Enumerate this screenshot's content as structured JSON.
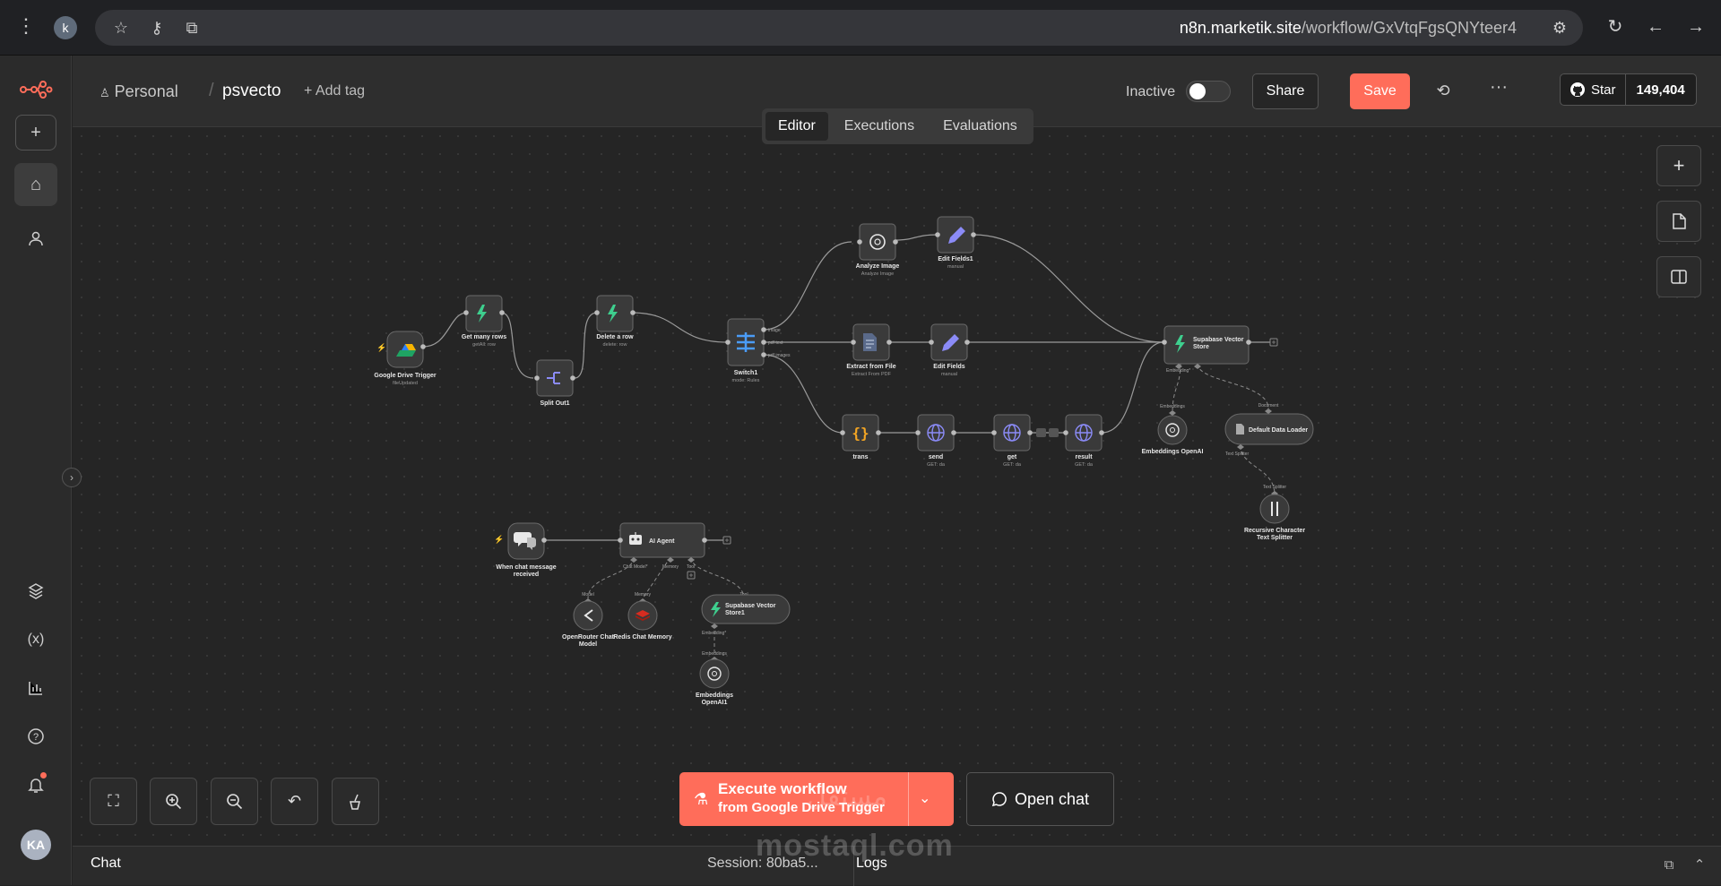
{
  "browser": {
    "avatar_letter": "k",
    "url_host": "n8n.marketik.site",
    "url_path": "/workflow/GxVtqFgsQNYteer4"
  },
  "header": {
    "breadcrumb_personal": "Personal",
    "project_name": "psvecto",
    "add_tag": "+ Add tag",
    "status_label": "Inactive",
    "share_label": "Share",
    "save_label": "Save",
    "github_star_label": "Star",
    "github_star_count": "149,404"
  },
  "tabs": [
    {
      "label": "Editor",
      "active": true
    },
    {
      "label": "Executions",
      "active": false
    },
    {
      "label": "Evaluations",
      "active": false
    }
  ],
  "sidebar": {
    "avatar_initials": "KA"
  },
  "workflow": {
    "nodes": [
      {
        "id": "gdrive",
        "label": "Google Drive Trigger",
        "sub": "fileUpdated"
      },
      {
        "id": "getrows",
        "label": "Get many rows",
        "sub": "getAll: row"
      },
      {
        "id": "split",
        "label": "Split Out1",
        "sub": ""
      },
      {
        "id": "delete",
        "label": "Delete a row",
        "sub": "delete: row"
      },
      {
        "id": "switch",
        "label": "Switch1",
        "sub": "mode: Rules"
      },
      {
        "id": "analyze",
        "label": "Analyze Image",
        "sub": "Analyze Image"
      },
      {
        "id": "edit1",
        "label": "Edit Fields1",
        "sub": "manual"
      },
      {
        "id": "extract",
        "label": "Extract from File",
        "sub": "Extract From PDF"
      },
      {
        "id": "edit",
        "label": "Edit Fields",
        "sub": "manual"
      },
      {
        "id": "trans",
        "label": "trans",
        "sub": ""
      },
      {
        "id": "send",
        "label": "send",
        "sub": "GET: da"
      },
      {
        "id": "get",
        "label": "get",
        "sub": "GET: da"
      },
      {
        "id": "result",
        "label": "result",
        "sub": "GET: da"
      },
      {
        "id": "supabase",
        "label": "Supabase Vector Store",
        "sub": ""
      },
      {
        "id": "emb1",
        "label": "Embeddings OpenAI",
        "sub": ""
      },
      {
        "id": "loader",
        "label": "Default Data Loader",
        "sub": ""
      },
      {
        "id": "splitter",
        "label": "Recursive Character Text Splitter",
        "sub": ""
      },
      {
        "id": "chat",
        "label": "When chat message received",
        "sub": ""
      },
      {
        "id": "agent",
        "label": "AI Agent",
        "sub": ""
      },
      {
        "id": "openrouter",
        "label": "OpenRouter Chat Model",
        "sub": ""
      },
      {
        "id": "redis",
        "label": "Redis Chat Memory",
        "sub": ""
      },
      {
        "id": "supabase1",
        "label": "Supabase Vector Store1",
        "sub": ""
      },
      {
        "id": "emb2",
        "label": "Embeddings OpenAI",
        "sub": ""
      }
    ],
    "switch_outputs": [
      "image",
      "pdf text",
      "pdf images"
    ],
    "port_labels": {
      "embedding": "Embedding*",
      "embeddings": "Embeddings",
      "document": "Document",
      "text_splitter": "Text Splitter",
      "chat_model": "Chat Model*",
      "memory": "Memory",
      "tool": "Tool",
      "model": "Model"
    }
  },
  "canvas_actions": {
    "execute_line1": "Execute workflow",
    "execute_line2": "from Google Drive Trigger",
    "open_chat": "Open chat"
  },
  "bottom_panel": {
    "chat_label": "Chat",
    "session_label": "Session: 80ba5...",
    "logs_label": "Logs"
  },
  "watermark": {
    "latin": "mostaql.com",
    "arabic": "مستقل"
  },
  "colors": {
    "accent": "#ff6d5a",
    "canvas": "#252525",
    "node_fill": "#3a3a3a",
    "connector": "#9a9a9a"
  }
}
